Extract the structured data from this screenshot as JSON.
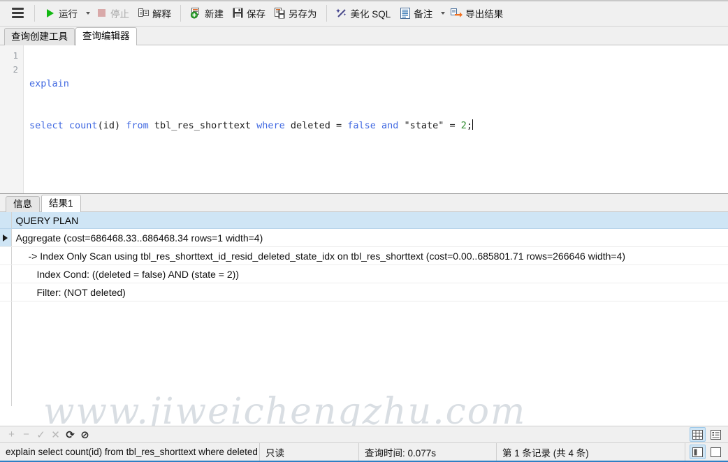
{
  "window": {
    "title": "查询编辑器"
  },
  "toolbar": {
    "menu_icon": "hamburger-icon",
    "buttons": [
      {
        "id": "run",
        "label": "运行",
        "icon": "play-icon",
        "disabled": false,
        "dropdown": true
      },
      {
        "id": "stop",
        "label": "停止",
        "icon": "stop-icon",
        "disabled": true,
        "dropdown": false
      },
      {
        "id": "explain",
        "label": "解释",
        "icon": "explain-icon",
        "disabled": false,
        "dropdown": false
      },
      {
        "id": "new",
        "label": "新建",
        "icon": "new-query-icon",
        "disabled": false,
        "dropdown": false
      },
      {
        "id": "save",
        "label": "保存",
        "icon": "save-icon",
        "disabled": false,
        "dropdown": false
      },
      {
        "id": "saveas",
        "label": "另存为",
        "icon": "save-as-icon",
        "disabled": false,
        "dropdown": false
      },
      {
        "id": "beautify",
        "label": "美化 SQL",
        "icon": "magic-wand-icon",
        "disabled": false,
        "dropdown": false
      },
      {
        "id": "note",
        "label": "备注",
        "icon": "note-icon",
        "disabled": false,
        "dropdown": true
      },
      {
        "id": "export",
        "label": "导出结果",
        "icon": "export-icon",
        "disabled": false,
        "dropdown": false
      }
    ]
  },
  "tabs": [
    {
      "id": "builder",
      "label": "查询创建工具",
      "active": false
    },
    {
      "id": "editor",
      "label": "查询编辑器",
      "active": true
    }
  ],
  "editor": {
    "line_numbers": [
      "1",
      "2"
    ],
    "lines": [
      [
        {
          "t": "explain",
          "c": "kw"
        }
      ],
      [
        {
          "t": "select",
          "c": "kw"
        },
        {
          "t": " ",
          "c": ""
        },
        {
          "t": "count",
          "c": "kw"
        },
        {
          "t": "(id) ",
          "c": ""
        },
        {
          "t": "from",
          "c": "kw"
        },
        {
          "t": " tbl_res_shorttext ",
          "c": ""
        },
        {
          "t": "where",
          "c": "kw"
        },
        {
          "t": " deleted = ",
          "c": ""
        },
        {
          "t": "false",
          "c": "kw"
        },
        {
          "t": " ",
          "c": ""
        },
        {
          "t": "and",
          "c": "kw"
        },
        {
          "t": " \"state\" = ",
          "c": ""
        },
        {
          "t": "2",
          "c": "num"
        },
        {
          "t": ";",
          "c": ""
        }
      ]
    ],
    "plain_text": "explain\nselect count(id) from tbl_res_shorttext where deleted = false and \"state\" = 2;"
  },
  "result_tabs": [
    {
      "id": "info",
      "label": "信息",
      "active": false
    },
    {
      "id": "result1",
      "label": "结果1",
      "active": true
    }
  ],
  "watermark": "www.jiweichengzhu.com",
  "grid": {
    "columns": [
      "QUERY PLAN"
    ],
    "rows": [
      {
        "text": "Aggregate  (cost=686468.33..686468.34 rows=1 width=4)",
        "indent": 0,
        "selected": true
      },
      {
        "text": "->  Index Only Scan using tbl_res_shorttext_id_resid_deleted_state_idx on tbl_res_shorttext  (cost=0.00..685801.71 rows=266646 width=4)",
        "indent": 1,
        "selected": false
      },
      {
        "text": "Index Cond: ((deleted = false) AND (state = 2))",
        "indent": 2,
        "selected": false
      },
      {
        "text": "Filter: (NOT deleted)",
        "indent": 2,
        "selected": false
      }
    ]
  },
  "navbar": {
    "buttons": [
      {
        "id": "add",
        "glyph": "+",
        "icon": "plus-icon",
        "enabled": false
      },
      {
        "id": "remove",
        "glyph": "−",
        "icon": "minus-icon",
        "enabled": false
      },
      {
        "id": "apply",
        "glyph": "✓",
        "icon": "check-icon",
        "enabled": false
      },
      {
        "id": "cancel",
        "glyph": "✕",
        "icon": "cross-icon",
        "enabled": false
      },
      {
        "id": "refresh",
        "glyph": "⟳",
        "icon": "refresh-icon",
        "enabled": true
      },
      {
        "id": "stopload",
        "glyph": "⊘",
        "icon": "no-entry-icon",
        "enabled": true
      }
    ],
    "view_buttons": [
      {
        "id": "grid-view",
        "icon": "grid-view-icon",
        "selected": true
      },
      {
        "id": "form-view",
        "icon": "form-view-icon",
        "selected": false
      }
    ]
  },
  "statusbar": {
    "sql": "explain select count(id) from tbl_res_shorttext where deleted = fal",
    "readonly": "只读",
    "query_time": "查询时间: 0.077s",
    "record_info": "第 1 条记录 (共 4 条)",
    "view_buttons": [
      {
        "id": "split-view",
        "icon": "split-view-icon",
        "selected": true
      },
      {
        "id": "single-view",
        "icon": "single-view-icon",
        "selected": false
      }
    ]
  },
  "colors": {
    "accent": "#2f7fc4",
    "header_bg": "#cfe5f5",
    "keyword": "#4169e1",
    "number": "#2e8b2e",
    "run_green": "#12b812",
    "toolbar_bg": "#f0f0f0"
  }
}
